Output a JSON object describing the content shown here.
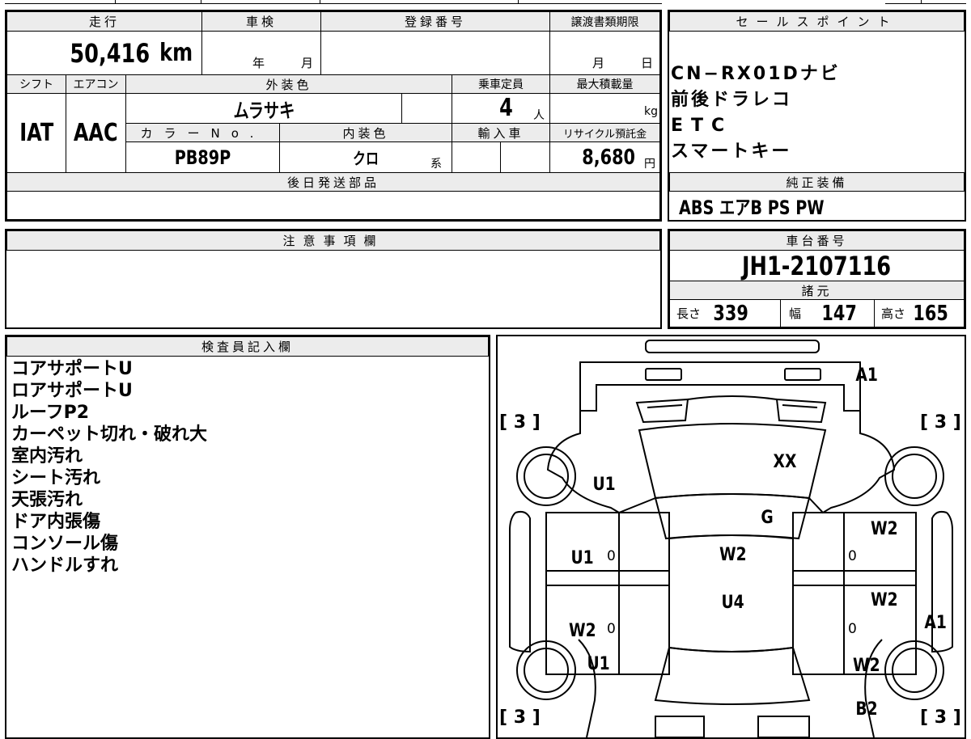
{
  "summary": {
    "mileage_label": "走行",
    "mileage_value": "50,416",
    "mileage_unit": "km",
    "inspection_label": "車検",
    "inspection_year": "年",
    "inspection_month": "月",
    "registration_label": "登録番号",
    "transfer_label": "譲渡書類期限",
    "transfer_month": "月",
    "transfer_day": "日",
    "shift_label": "シフト",
    "shift_value": "IAT",
    "ac_label": "エアコン",
    "ac_value": "AAC",
    "exterior_label": "外装色",
    "exterior_value": "ムラサキ",
    "color_no_label": "カラーNo.",
    "color_no_value": "PB89P",
    "interior_label": "内装色",
    "interior_value": "クロ",
    "interior_suffix": "系",
    "capacity_label": "乗車定員",
    "capacity_value": "4",
    "capacity_unit": "人",
    "max_load_label": "最大積載量",
    "max_load_unit": "kg",
    "import_label": "輸入車",
    "recycle_label": "リサイクル預託金",
    "recycle_value": "8,680",
    "recycle_unit": "円",
    "later_parts_label": "後日発送部品"
  },
  "sales_points": {
    "label": "セールスポイント",
    "items": [
      "CN−RX01Dナビ",
      "前後ドラレコ",
      "ETC",
      "スマートキー"
    ]
  },
  "factory_equipment": {
    "label": "純正装備",
    "value": "ABS エアB PS PW"
  },
  "notes": {
    "label": "注意事項欄"
  },
  "chassis": {
    "label": "車台番号",
    "value": "JH1-2107116",
    "specs_label": "諸元",
    "length_label": "長さ",
    "length_value": "339",
    "width_label": "幅",
    "width_value": "147",
    "height_label": "高さ",
    "height_value": "165"
  },
  "inspector": {
    "label": "検査員記入欄",
    "items": [
      "コアサポートU",
      "ロアサポートU",
      "ルーフP2",
      "カーペット切れ・破れ大",
      "室内汚れ",
      "シート汚れ",
      "天張汚れ",
      "ドア内張傷",
      "コンソール傷",
      "ハンドルすれ"
    ]
  },
  "diagram": {
    "marks": {
      "a1_top": "A1",
      "xx": "XX",
      "u1_fender_l": "U1",
      "g": "G",
      "w2_fender_r": "W2",
      "u1_door_fl": "U1",
      "w2_roof": "W2",
      "u4": "U4",
      "w2_door_fr": "W2",
      "w2_door_rl": "W2",
      "a1_right": "A1",
      "u1_rear_l": "U1",
      "w2_rear_r": "W2",
      "b2": "B2"
    },
    "tires": {
      "fl": "3",
      "fr": "3",
      "rl": "3",
      "rr": "3"
    },
    "zeros": {
      "fl_door": "0",
      "fr_door": "0",
      "rl_door": "0",
      "rr_door": "0"
    }
  }
}
